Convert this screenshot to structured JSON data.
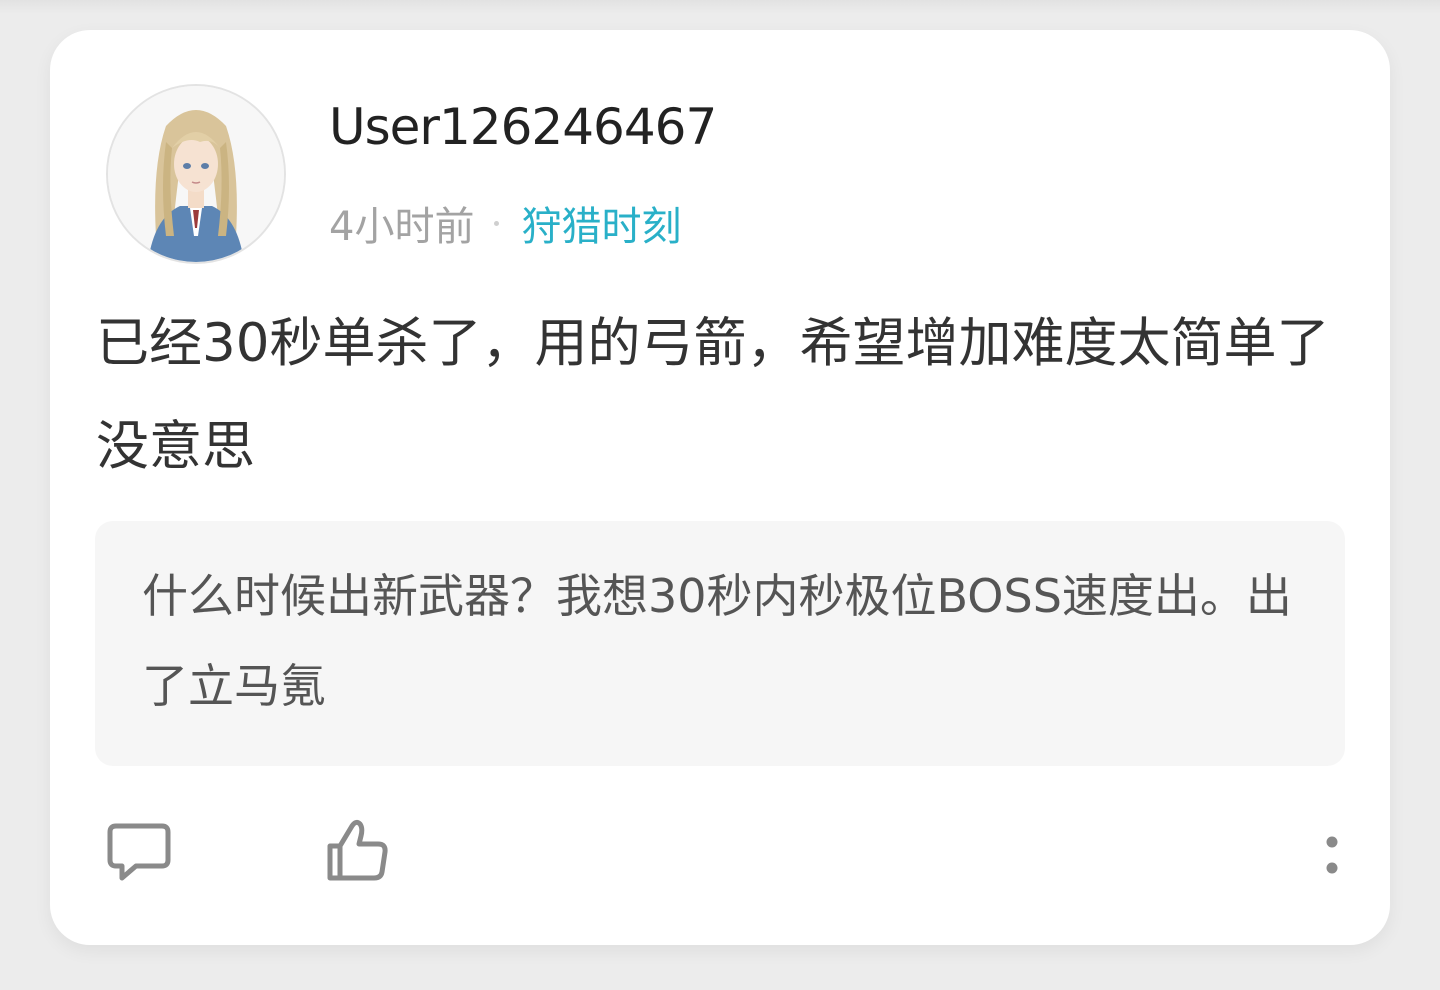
{
  "post": {
    "author": {
      "username": "User126246467",
      "avatar_icon": "avatar-image"
    },
    "time_ago": "4小时前",
    "category": "狩猎时刻",
    "body": "已经30秒单杀了，用的弓箭，希望增加难度太简单了没意思",
    "quoted": "什么时候出新武器？我想30秒内秒极位BOSS速度出。出了立马氪"
  },
  "actions": {
    "comment_icon": "comment-icon",
    "like_icon": "thumbs-up-icon",
    "more_icon": "more-vertical-icon"
  },
  "colors": {
    "accent": "#29b0c8",
    "text_primary": "#333333",
    "text_muted": "#a3a3a3",
    "quote_bg": "#f6f6f6",
    "icon": "#8a8a8a"
  }
}
